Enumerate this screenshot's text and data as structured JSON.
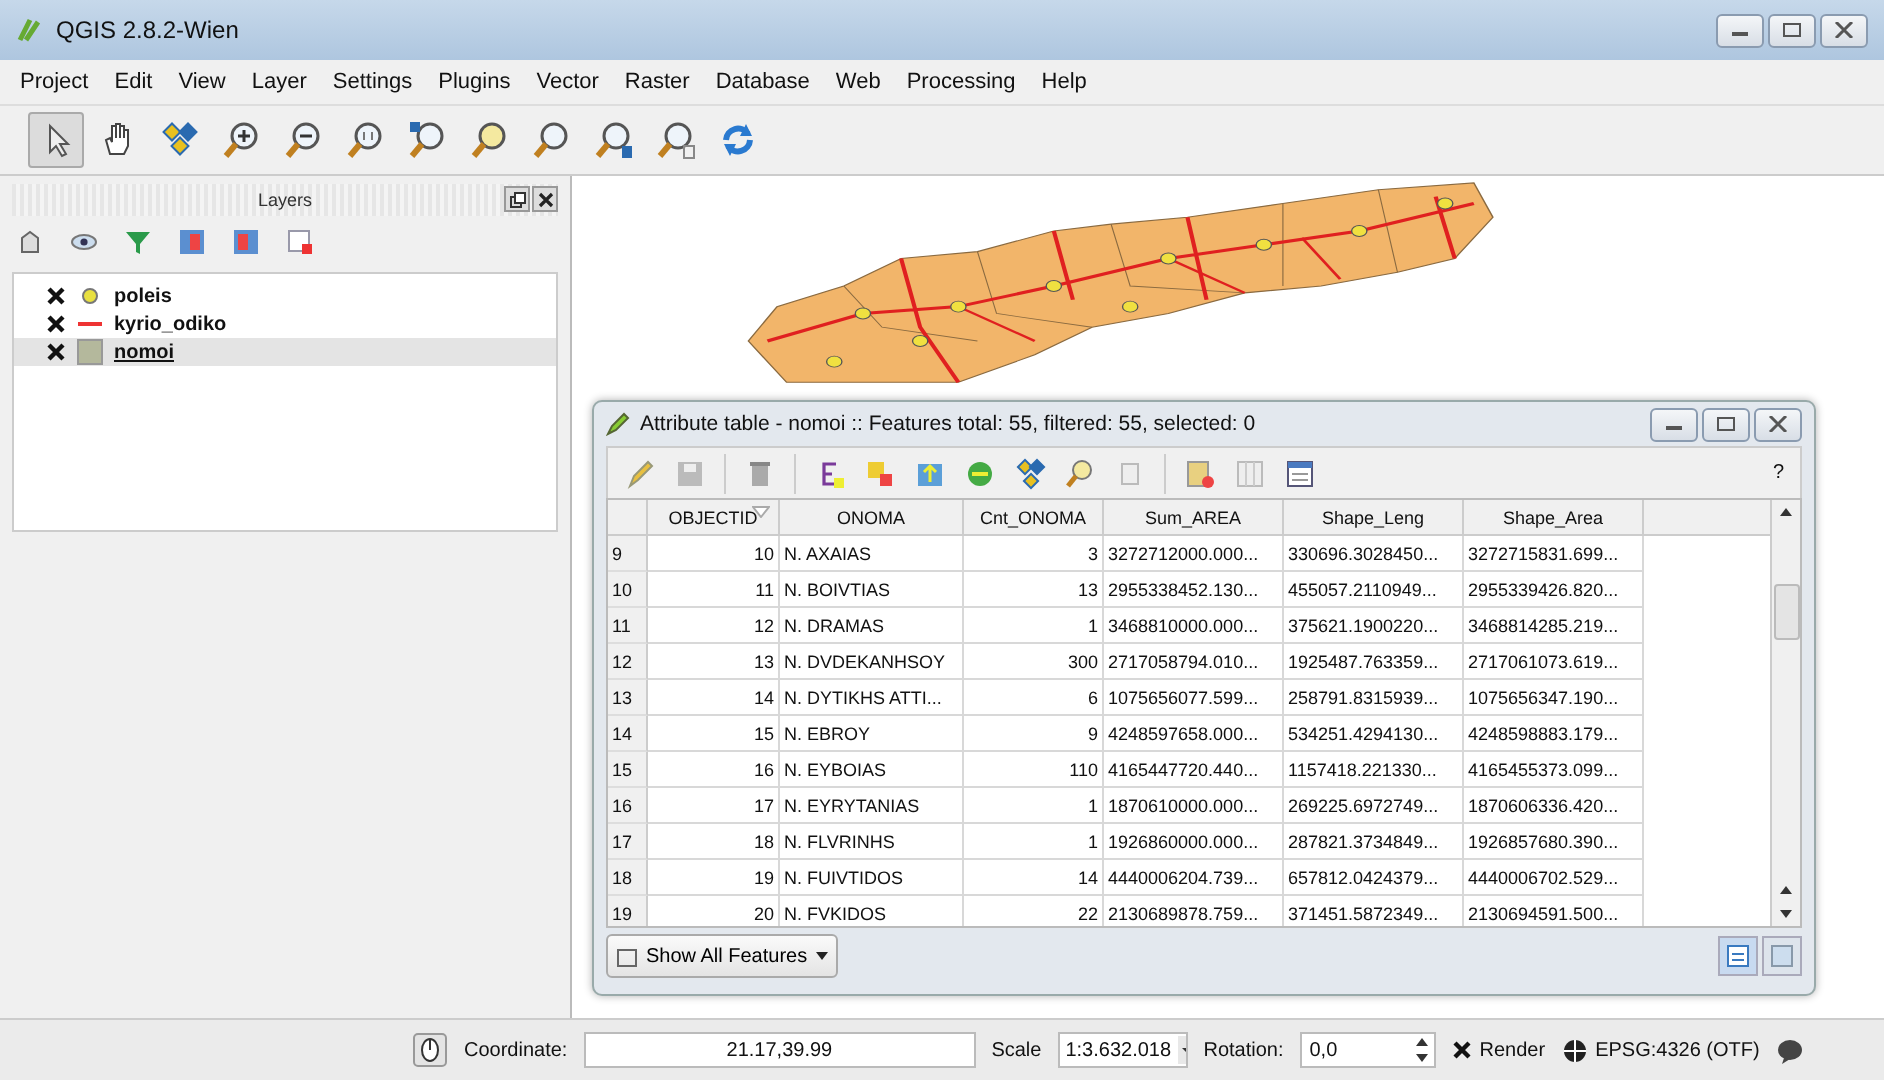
{
  "window": {
    "title": "QGIS 2.8.2-Wien"
  },
  "menu": [
    "Project",
    "Edit",
    "View",
    "Layer",
    "Settings",
    "Plugins",
    "Vector",
    "Raster",
    "Database",
    "Web",
    "Processing",
    "Help"
  ],
  "layers_panel": {
    "title": "Layers",
    "layers": [
      {
        "name": "poleis",
        "kind": "point",
        "visible": true,
        "selected": false
      },
      {
        "name": "kyrio_odiko",
        "kind": "line",
        "visible": true,
        "selected": false
      },
      {
        "name": "nomoi",
        "kind": "polygon",
        "visible": true,
        "selected": true
      }
    ]
  },
  "attribute_table": {
    "title": "Attribute table - nomoi :: Features total: 55, filtered: 55, selected: 0",
    "help": "?",
    "columns": [
      {
        "label": "OBJECTID",
        "sorted": true
      },
      {
        "label": "ONOMA",
        "sorted": false
      },
      {
        "label": "Cnt_ONOMA",
        "sorted": false
      },
      {
        "label": "Sum_AREA",
        "sorted": false
      },
      {
        "label": "Shape_Leng",
        "sorted": false
      },
      {
        "label": "Shape_Area",
        "sorted": false
      }
    ],
    "rows": [
      {
        "header": "9",
        "cells": [
          "10",
          "N. AXAIAS",
          "3",
          "3272712000.000...",
          "330696.3028450...",
          "3272715831.699..."
        ]
      },
      {
        "header": "10",
        "cells": [
          "11",
          "N. BOIVTIAS",
          "13",
          "2955338452.130...",
          "455057.2110949...",
          "2955339426.820..."
        ]
      },
      {
        "header": "11",
        "cells": [
          "12",
          "N. DRAMAS",
          "1",
          "3468810000.000...",
          "375621.1900220...",
          "3468814285.219..."
        ]
      },
      {
        "header": "12",
        "cells": [
          "13",
          "N. DVDEKANHSOY",
          "300",
          "2717058794.010...",
          "1925487.763359...",
          "2717061073.619..."
        ]
      },
      {
        "header": "13",
        "cells": [
          "14",
          "N. DYTIKHS ATTI...",
          "6",
          "1075656077.599...",
          "258791.8315939...",
          "1075656347.190..."
        ]
      },
      {
        "header": "14",
        "cells": [
          "15",
          "N. EBROY",
          "9",
          "4248597658.000...",
          "534251.4294130...",
          "4248598883.179..."
        ]
      },
      {
        "header": "15",
        "cells": [
          "16",
          "N. EYBOIAS",
          "110",
          "4165447720.440...",
          "1157418.221330...",
          "4165455373.099..."
        ]
      },
      {
        "header": "16",
        "cells": [
          "17",
          "N. EYRYTANIAS",
          "1",
          "1870610000.000...",
          "269225.6972749...",
          "1870606336.420..."
        ]
      },
      {
        "header": "17",
        "cells": [
          "18",
          "N. FLVRINHS",
          "1",
          "1926860000.000...",
          "287821.3734849...",
          "1926857680.390..."
        ]
      },
      {
        "header": "18",
        "cells": [
          "19",
          "N. FUIVTIDOS",
          "14",
          "4440006204.739...",
          "657812.0424379...",
          "4440006702.529..."
        ]
      },
      {
        "header": "19",
        "cells": [
          "20",
          "N. FVKIDOS",
          "22",
          "2130689878.759...",
          "371451.5872349...",
          "2130694591.500..."
        ]
      }
    ],
    "filter_button": "Show All Features"
  },
  "status_bar": {
    "coordinate_label": "Coordinate:",
    "coordinate": "21.17,39.99",
    "scale_label": "Scale",
    "scale": "1:3.632.018",
    "rotation_label": "Rotation:",
    "rotation": "0,0",
    "render": {
      "label": "Render",
      "checked": true
    },
    "crs": "EPSG:4326 (OTF)"
  }
}
